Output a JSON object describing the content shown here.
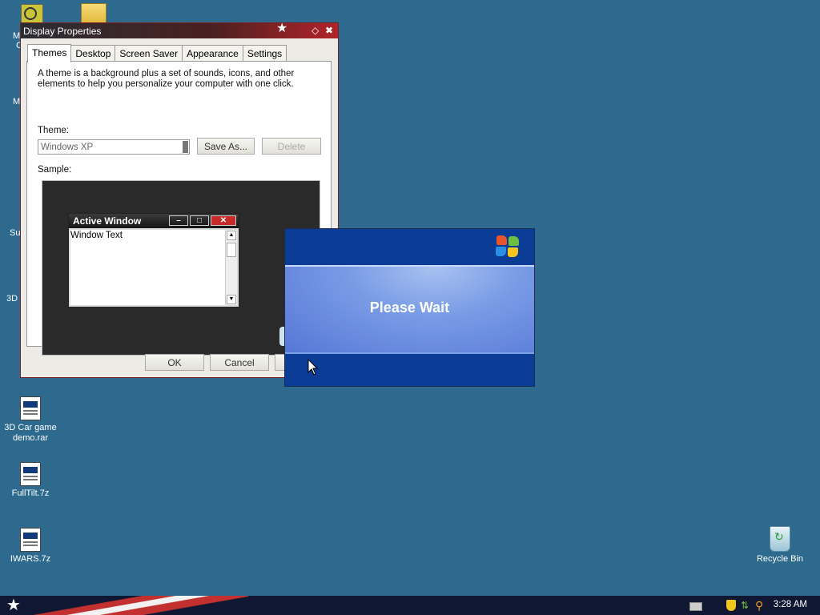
{
  "desktop": {
    "icons": [
      {
        "label": "3D Car game demo.rar"
      },
      {
        "label": "FullTilt.7z"
      },
      {
        "label": "IWARS.7z"
      },
      {
        "label": "Recycle Bin"
      }
    ],
    "partial_labels": [
      "M",
      "C",
      "M",
      "Su",
      "3D"
    ]
  },
  "display_properties": {
    "title": "Display Properties",
    "tabs": [
      "Themes",
      "Desktop",
      "Screen Saver",
      "Appearance",
      "Settings"
    ],
    "description": "A theme is a background plus a set of sounds, icons, and other elements to help you personalize your computer with one click.",
    "theme_label": "Theme:",
    "theme_value": "Windows XP",
    "save_as": "Save As...",
    "delete": "Delete",
    "sample_label": "Sample:",
    "active_window_title": "Active Window",
    "window_text": "Window Text",
    "ok": "OK",
    "cancel": "Cancel"
  },
  "please_wait": {
    "message": "Please Wait"
  },
  "taskbar": {
    "clock": "3:28 AM"
  },
  "colors": {
    "desktop": "#2d6a8e",
    "dialog_blue": "#0b3d96"
  }
}
